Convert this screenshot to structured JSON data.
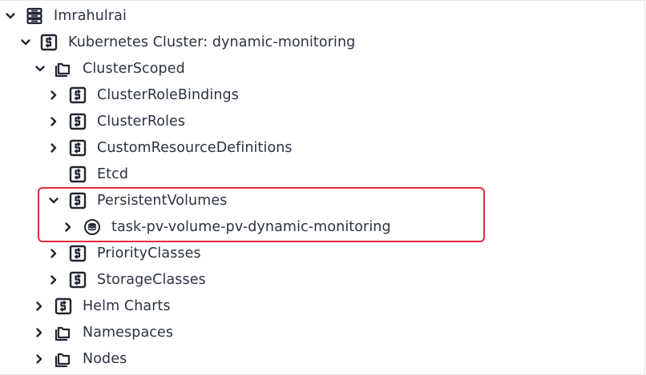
{
  "tree": {
    "items": [
      {
        "label": "Imrahulrai",
        "icon": "database-server-icon",
        "chevron": "down"
      },
      {
        "label": "Kubernetes Cluster: dynamic-monitoring",
        "icon": "resource-box-icon",
        "chevron": "down"
      },
      {
        "label": "ClusterScoped",
        "icon": "folder-stack-icon",
        "chevron": "down"
      },
      {
        "label": "ClusterRoleBindings",
        "icon": "resource-box-icon",
        "chevron": "right"
      },
      {
        "label": "ClusterRoles",
        "icon": "resource-box-icon",
        "chevron": "right"
      },
      {
        "label": "CustomResourceDefinitions",
        "icon": "resource-box-icon",
        "chevron": "right"
      },
      {
        "label": "Etcd",
        "icon": "resource-box-icon",
        "chevron": "none"
      },
      {
        "label": "PersistentVolumes",
        "icon": "resource-box-icon",
        "chevron": "down"
      },
      {
        "label": "task-pv-volume-pv-dynamic-monitoring",
        "icon": "persistent-volume-icon",
        "chevron": "right"
      },
      {
        "label": "PriorityClasses",
        "icon": "resource-box-icon",
        "chevron": "right"
      },
      {
        "label": "StorageClasses",
        "icon": "resource-box-icon",
        "chevron": "right"
      },
      {
        "label": "Helm Charts",
        "icon": "resource-box-icon",
        "chevron": "right"
      },
      {
        "label": "Namespaces",
        "icon": "folder-stack-icon",
        "chevron": "right"
      },
      {
        "label": "Nodes",
        "icon": "folder-stack-icon",
        "chevron": "right"
      }
    ]
  },
  "colors": {
    "text": "#2b3340",
    "highlight_border": "#e12c3f"
  }
}
